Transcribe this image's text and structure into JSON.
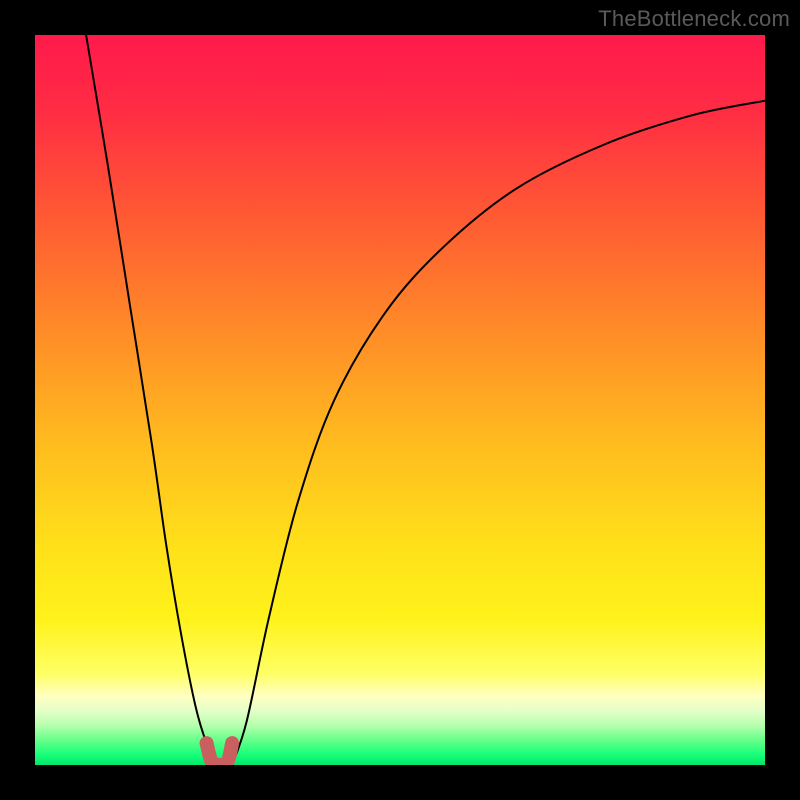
{
  "watermark": "TheBottleneck.com",
  "gradient_stops": [
    {
      "offset": 0.0,
      "color": "#ff1a4b"
    },
    {
      "offset": 0.1,
      "color": "#ff2b44"
    },
    {
      "offset": 0.25,
      "color": "#ff5a33"
    },
    {
      "offset": 0.4,
      "color": "#ff8a28"
    },
    {
      "offset": 0.55,
      "color": "#ffb91f"
    },
    {
      "offset": 0.7,
      "color": "#ffe01a"
    },
    {
      "offset": 0.8,
      "color": "#fff21a"
    },
    {
      "offset": 0.875,
      "color": "#ffff66"
    },
    {
      "offset": 0.905,
      "color": "#ffffc0"
    },
    {
      "offset": 0.925,
      "color": "#e6ffc8"
    },
    {
      "offset": 0.945,
      "color": "#b8ffb0"
    },
    {
      "offset": 0.965,
      "color": "#6aff8a"
    },
    {
      "offset": 0.985,
      "color": "#1aff7a"
    },
    {
      "offset": 1.0,
      "color": "#00e86a"
    }
  ],
  "marker": {
    "color": "#c9605f",
    "stroke_width": 14,
    "linecap": "round"
  },
  "curve": {
    "color": "#000000",
    "stroke_width": 2
  },
  "chart_data": {
    "type": "line",
    "title": "",
    "xlabel": "",
    "ylabel": "",
    "xlim": [
      0,
      100
    ],
    "ylim": [
      0,
      100
    ],
    "grid": false,
    "legend": false,
    "annotations": [
      "TheBottleneck.com"
    ],
    "series": [
      {
        "name": "bottleneck-curve-left",
        "comment": "Steep descending branch from top-left toward the minimum",
        "x": [
          7,
          10,
          13,
          16,
          18,
          20,
          22,
          23.5,
          25
        ],
        "y": [
          100,
          82,
          63,
          44,
          30,
          18,
          8,
          3,
          0
        ]
      },
      {
        "name": "bottleneck-curve-right",
        "comment": "Rising branch from the minimum sweeping to the upper right",
        "x": [
          27,
          29,
          32,
          36,
          41,
          48,
          56,
          66,
          78,
          90,
          100
        ],
        "y": [
          0,
          6,
          20,
          36,
          50,
          62,
          71,
          79,
          85,
          89,
          91
        ]
      },
      {
        "name": "optimal-marker",
        "comment": "Small U-shaped highlight at the curve minimum (optimal / no-bottleneck point)",
        "x": [
          23.5,
          24.2,
          25.3,
          26.4,
          27.0
        ],
        "y": [
          3.0,
          0.5,
          0.0,
          0.5,
          3.0
        ]
      }
    ],
    "background_gradient": {
      "direction": "top-to-bottom",
      "meaning": "red = high bottleneck, green = low / none",
      "stops_ref": "gradient_stops"
    }
  }
}
